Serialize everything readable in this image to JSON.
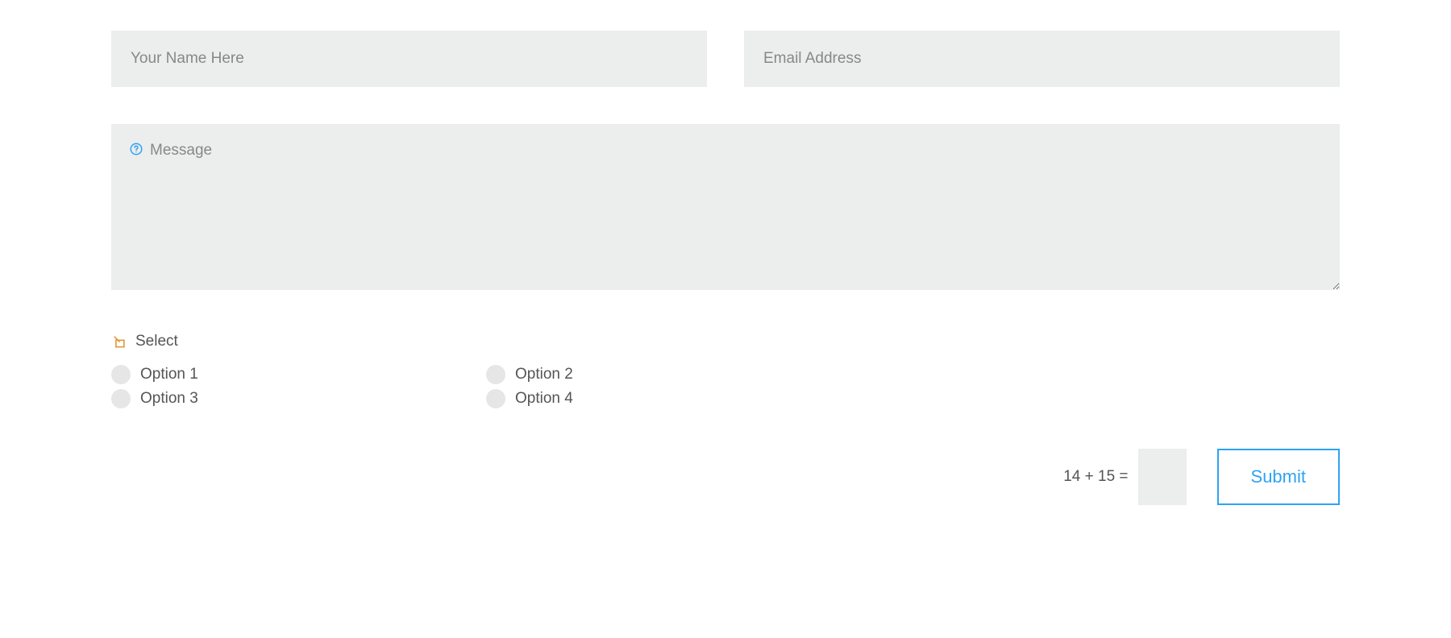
{
  "form": {
    "name": {
      "placeholder": "Your Name Here",
      "value": ""
    },
    "email": {
      "placeholder": "Email Address",
      "value": ""
    },
    "message": {
      "placeholder": "Message",
      "value": ""
    },
    "select": {
      "label": "Select",
      "options": [
        "Option 1",
        "Option 2",
        "Option 3",
        "Option 4"
      ]
    },
    "captcha": {
      "question": "14 + 15 =",
      "value": ""
    },
    "submit_label": "Submit"
  },
  "colors": {
    "accent": "#2ea3f2",
    "field_bg": "#eceded",
    "link_icon": "#e09b3d",
    "help_icon": "#2ea3f2"
  }
}
